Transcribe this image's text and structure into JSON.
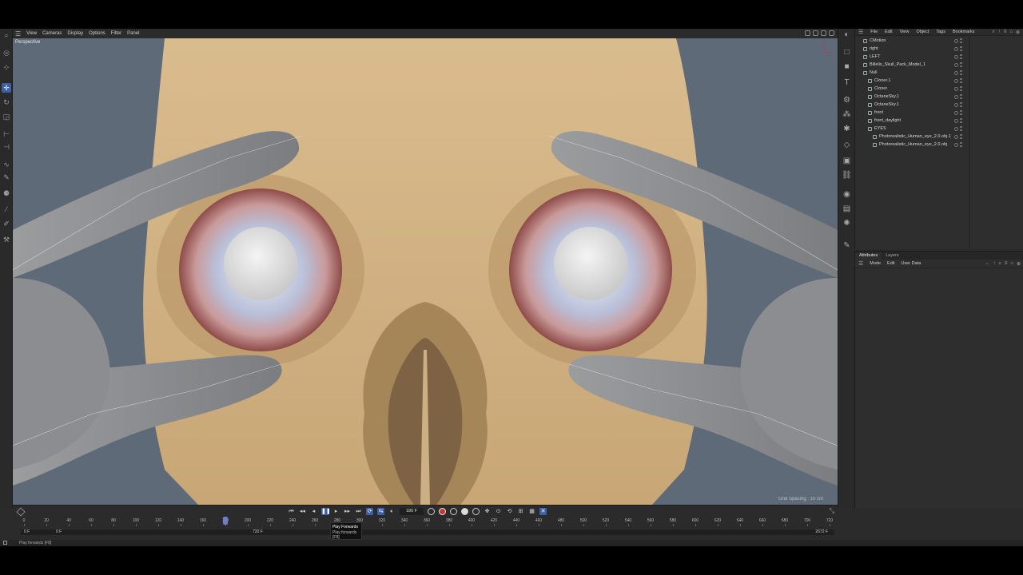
{
  "viewport": {
    "menus": [
      "View",
      "Cameras",
      "Display",
      "Options",
      "Filter",
      "Panel"
    ],
    "label": "Perspective",
    "stats": "Grid Spacing : 10 cm"
  },
  "object_manager": {
    "menus": [
      "File",
      "Edit",
      "View",
      "Object",
      "Tags",
      "Bookmarks"
    ],
    "objects": [
      {
        "name": "CMotion",
        "depth": 0
      },
      {
        "name": "right",
        "depth": 0
      },
      {
        "name": "LEFT",
        "depth": 0
      },
      {
        "name": "Billelis_Skull_Pack_Model_1",
        "depth": 0
      },
      {
        "name": "Null",
        "depth": 0
      },
      {
        "name": "Cloner.1",
        "depth": 1
      },
      {
        "name": "Cloner",
        "depth": 1
      },
      {
        "name": "OctaneSky.1",
        "depth": 1
      },
      {
        "name": "OctaneSky.1",
        "depth": 1
      },
      {
        "name": "front",
        "depth": 1
      },
      {
        "name": "front_daylight",
        "depth": 1
      },
      {
        "name": "EYES",
        "depth": 1
      },
      {
        "name": "Photorealistic_Human_eye_2.0.obj.1",
        "depth": 2
      },
      {
        "name": "Photorealistic_Human_eye_2.0.obj",
        "depth": 2
      }
    ]
  },
  "attributes": {
    "tabs": [
      "Attributes",
      "Layers"
    ],
    "menus": [
      "Mode",
      "Edit",
      "User Data"
    ]
  },
  "timeline": {
    "current_frame": "180 F",
    "ticks": [
      "0",
      "20",
      "40",
      "60",
      "80",
      "100",
      "120",
      "140",
      "160",
      "180",
      "200",
      "220",
      "240",
      "260",
      "280",
      "300",
      "320",
      "340",
      "360",
      "380",
      "400",
      "420",
      "440",
      "460",
      "480",
      "500",
      "520",
      "540",
      "560",
      "580",
      "600",
      "620",
      "640",
      "660",
      "680",
      "700",
      "720"
    ],
    "playhead_frame": 180,
    "max_frame": 720,
    "range_start": "0 F",
    "range_min": "0 F",
    "range_max": "720 F",
    "range_end": "2672 F"
  },
  "tooltip": {
    "title": "Play Forwards",
    "desc": "Play forwards",
    "shortcut": "[F8]"
  },
  "status": {
    "text": "Play forwards [F8]"
  },
  "colors": {
    "viewport_bg": "#5f6a78",
    "skull": "#d6b688",
    "hand": "#8a8c8e",
    "accent": "#3d5fa8"
  }
}
